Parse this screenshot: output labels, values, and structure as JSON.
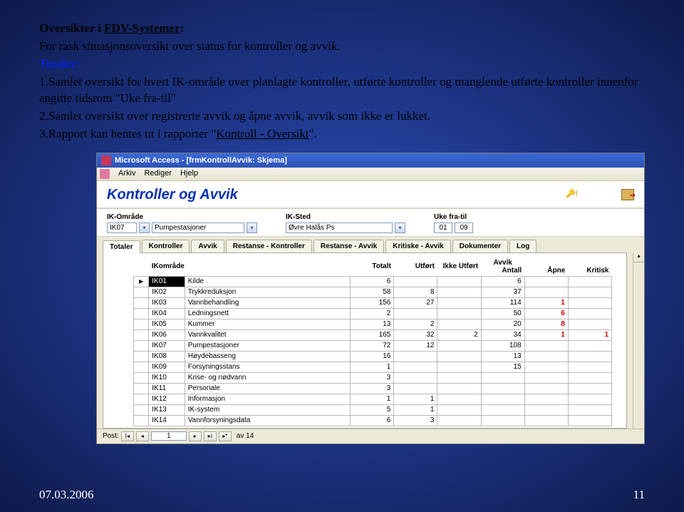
{
  "slide": {
    "heading_lead": "   Oversikter i ",
    "heading_link": "FDV-Systemer",
    "heading_tail": ":",
    "intro": "For rask situasjonsoversikt over status for kontroller og avvik.",
    "totaler_label": "Totaler:",
    "point1": "1.Samlet oversikt for hvert IK-område over planlagte kontroller, utførte kontroller og manglende utførte kontroller innenfor angitte tidsrom \"Uke fra-til\"",
    "point2a": "2.Samlet oversikt over registrerte avvik og åpne avvik, avvik som ikke er lukket.",
    "point3a": "3.Rapport kan hentes ut i rapporter \"",
    "point3link": "Kontroll - Oversikt",
    "point3b": "\"."
  },
  "app": {
    "window_title": "Microsoft Access - [frmKontrollAvvik: Skjema]",
    "menu": {
      "arkiv": "Arkiv",
      "rediger": "Rediger",
      "hjelp": "Hjelp"
    },
    "header_title": "Kontroller og Avvik",
    "filters": {
      "ik_omrade_label": "IK-Område",
      "ik_omrade_code": "IK07",
      "ik_omrade_desc": "Pumpestasjoner",
      "ik_sted_label": "IK-Sted",
      "ik_sted_value": "Øvre Halås Ps",
      "uke_label": "Uke fra-til",
      "uke_from": "01",
      "uke_to": "09"
    },
    "tabs": [
      "Totaler",
      "Kontroller",
      "Avvik",
      "Restanse - Kontroller",
      "Restanse - Avvik",
      "Kritiske - Avvik",
      "Dokumenter",
      "Log"
    ],
    "columns": {
      "ikomrade": "IKområde",
      "totalt": "Totalt",
      "utfort": "Utført",
      "ikke_utfort": "Ikke Utført",
      "avvik_group": "Avvik",
      "antall": "Antall",
      "apne": "Åpne",
      "kritisk": "Kritisk"
    },
    "rows": [
      {
        "code": "IK01",
        "desc": "Kilde",
        "totalt": "6",
        "utfort": "",
        "ikke": "",
        "antall": "6",
        "apne": "",
        "kritisk": ""
      },
      {
        "code": "IK02",
        "desc": "Trykkreduksjon",
        "totalt": "58",
        "utfort": "8",
        "ikke": "",
        "antall": "37",
        "apne": "",
        "kritisk": ""
      },
      {
        "code": "IK03",
        "desc": "Vannbehandling",
        "totalt": "156",
        "utfort": "27",
        "ikke": "",
        "antall": "114",
        "apne": "1",
        "kritisk": ""
      },
      {
        "code": "IK04",
        "desc": "Ledningsnett",
        "totalt": "2",
        "utfort": "",
        "ikke": "",
        "antall": "50",
        "apne": "6",
        "kritisk": ""
      },
      {
        "code": "IK05",
        "desc": "Kummer",
        "totalt": "13",
        "utfort": "2",
        "ikke": "",
        "antall": "20",
        "apne": "8",
        "kritisk": ""
      },
      {
        "code": "IK06",
        "desc": "Vannkvalitet",
        "totalt": "165",
        "utfort": "32",
        "ikke": "2",
        "antall": "34",
        "apne": "1",
        "kritisk": "1"
      },
      {
        "code": "IK07",
        "desc": "Pumpestasjoner",
        "totalt": "72",
        "utfort": "12",
        "ikke": "",
        "antall": "108",
        "apne": "",
        "kritisk": ""
      },
      {
        "code": "IK08",
        "desc": "Høydebasseng",
        "totalt": "16",
        "utfort": "",
        "ikke": "",
        "antall": "13",
        "apne": "",
        "kritisk": ""
      },
      {
        "code": "IK09",
        "desc": "Forsyningsstans",
        "totalt": "1",
        "utfort": "",
        "ikke": "",
        "antall": "15",
        "apne": "",
        "kritisk": ""
      },
      {
        "code": "IK10",
        "desc": "Krise- og nødvann",
        "totalt": "3",
        "utfort": "",
        "ikke": "",
        "antall": "",
        "apne": "",
        "kritisk": ""
      },
      {
        "code": "IK11",
        "desc": "Personale",
        "totalt": "3",
        "utfort": "",
        "ikke": "",
        "antall": "",
        "apne": "",
        "kritisk": ""
      },
      {
        "code": "IK12",
        "desc": "Informasjon",
        "totalt": "1",
        "utfort": "1",
        "ikke": "",
        "antall": "",
        "apne": "",
        "kritisk": ""
      },
      {
        "code": "IK13",
        "desc": "IK-system",
        "totalt": "5",
        "utfort": "1",
        "ikke": "",
        "antall": "",
        "apne": "",
        "kritisk": ""
      },
      {
        "code": "IK14",
        "desc": "Vannforsyningsdata",
        "totalt": "6",
        "utfort": "3",
        "ikke": "",
        "antall": "",
        "apne": "",
        "kritisk": ""
      }
    ],
    "recordnav": {
      "post_label": "Post:",
      "current": "1",
      "of_label": "av 14"
    }
  },
  "footer": {
    "date": "07.03.2006",
    "page": "11"
  }
}
